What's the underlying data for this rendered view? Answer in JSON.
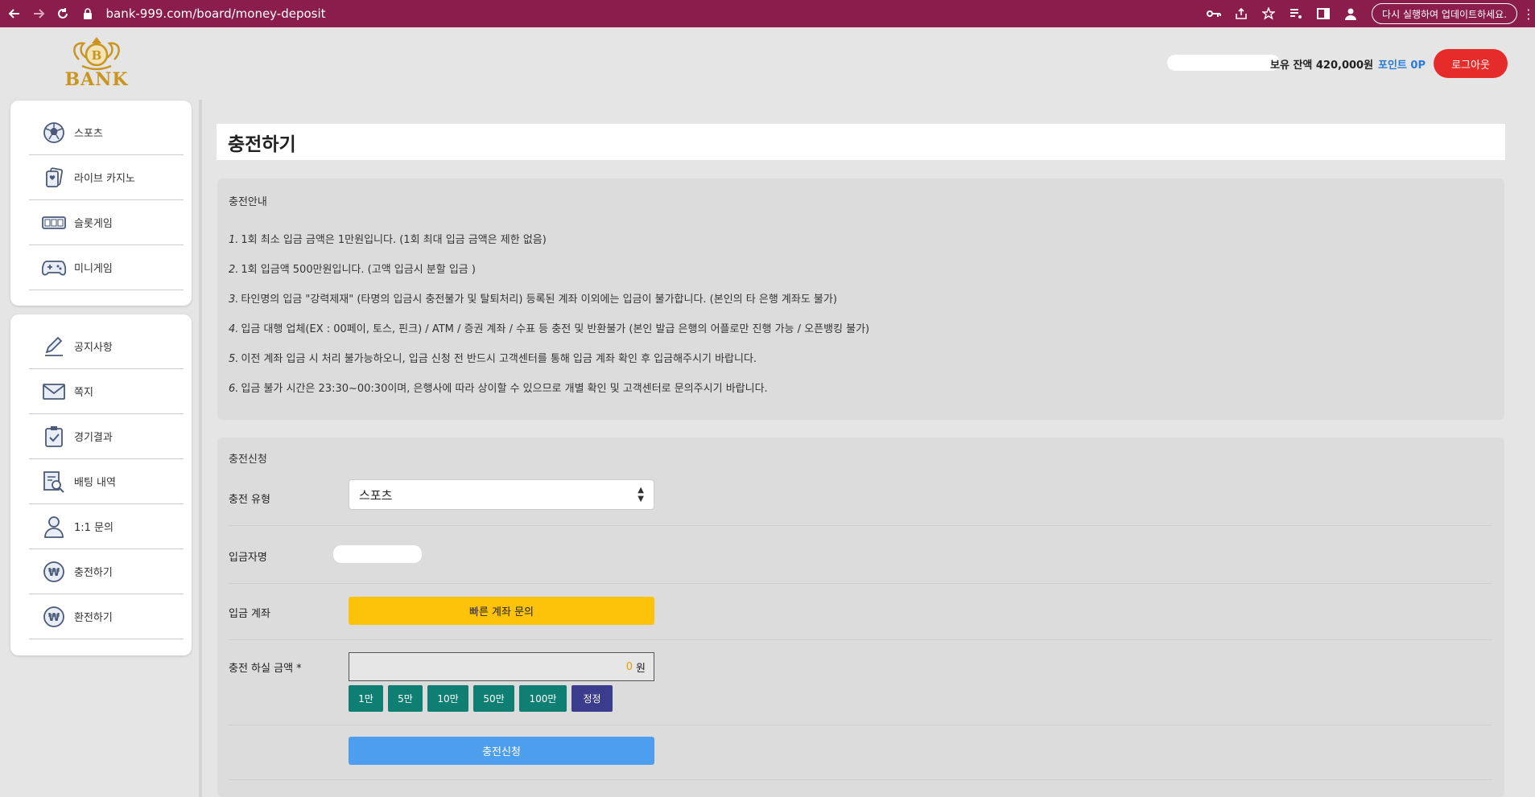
{
  "browser": {
    "url": "bank-999.com/board/money-deposit",
    "update_label": "다시 실행하여 업데이트하세요."
  },
  "header": {
    "logo_letter": "B",
    "logo_text": "BANK",
    "balance_label": "보유 잔액 420,000원",
    "points_label": "포인트 0P",
    "logout_label": "로그아웃"
  },
  "sidebar": {
    "games": [
      {
        "label": "스포츠",
        "icon": "soccer-ball-icon"
      },
      {
        "label": "라이브 카지노",
        "icon": "playing-cards-icon"
      },
      {
        "label": "슬롯게임",
        "icon": "slot-machine-icon"
      },
      {
        "label": "미니게임",
        "icon": "gamepad-icon"
      }
    ],
    "menu": [
      {
        "label": "공지사항",
        "icon": "pencil-icon"
      },
      {
        "label": "쪽지",
        "icon": "envelope-icon"
      },
      {
        "label": "경기결과",
        "icon": "clipboard-check-icon"
      },
      {
        "label": "배팅 내역",
        "icon": "document-search-icon"
      },
      {
        "label": "1:1 문의",
        "icon": "person-icon"
      },
      {
        "label": "충전하기",
        "icon": "won-coin-icon"
      },
      {
        "label": "환전하기",
        "icon": "won-coin-icon"
      }
    ]
  },
  "main": {
    "title": "충전하기",
    "info": {
      "heading": "충전안내",
      "lines": [
        {
          "num": "1.",
          "text": "1회 최소 입금 금액은 1만원입니다. (1회 최대 입금 금액은 제한 없음)"
        },
        {
          "num": "2.",
          "text": "1회 입금액 500만원입니다. (고액 입금시 분할 입금 )"
        },
        {
          "num": "3.",
          "text": "타인명의 입금 \"강력제재\" (타명의 입금시 충전불가 및 탈퇴처리) 등록된 계좌 이외에는 입금이 불가합니다. (본인의 타 은행 계좌도 불가)"
        },
        {
          "num": "4.",
          "text": "입금 대행 업체(EX : 00페이, 토스, 핀크) / ATM / 증권 계좌 / 수표 등 충전 및 반환불가 (본인 발급 은행의 어플로만 진행 가능 / 오픈뱅킹 불가)"
        },
        {
          "num": "5.",
          "text": "이전 계좌 입금 시 처리 불가능하오니, 입금 신청 전 반드시 고객센터를 통해 입금 계좌 확인 후 입금해주시기 바랍니다."
        },
        {
          "num": "6.",
          "text": "입금 불가 시간은 23:30~00:30이며, 은행사에 따라 상이할 수 있으므로 개별 확인 및 고객센터로 문의주시기 바랍니다."
        }
      ]
    },
    "form": {
      "heading": "충전신청",
      "type_label": "충전 유형",
      "type_value": "스포츠",
      "depositor_label": "입금자명",
      "account_label": "입금 계좌",
      "account_button": "빠른 계좌 문의",
      "amount_label": "충전 하실 금액 *",
      "amount_value": "0",
      "amount_unit": "원",
      "chips": [
        "1만",
        "5만",
        "10만",
        "50만",
        "100만"
      ],
      "reset_label": "정정",
      "submit_label": "충전신청"
    }
  },
  "colors": {
    "browser_bar": "#8a1d4c",
    "logout": "#e62b2b",
    "points": "#2a7bd8",
    "quick_account": "#fdc20a",
    "chip": "#0f7f73",
    "reset": "#3b3c8e",
    "submit": "#4e9ef0",
    "logo_gold": "#c9951f"
  }
}
